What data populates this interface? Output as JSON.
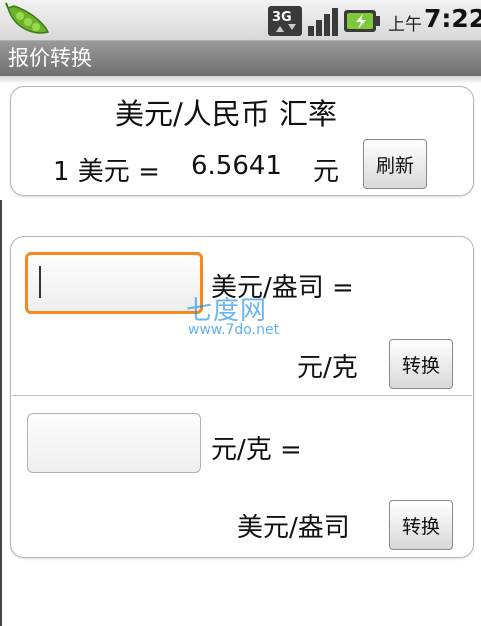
{
  "status_bar": {
    "network_label": "3G",
    "am_pm": "上午",
    "time": "7:22"
  },
  "app": {
    "title": "报价转换"
  },
  "rate_card": {
    "heading": "美元/人民币 汇率",
    "prefix": "1 美元 =",
    "rate_value": "6.5641",
    "unit": "元",
    "refresh_label": "刷新"
  },
  "convert_card": {
    "usd_oz": {
      "input_value": "",
      "unit_label": "美元/盎司 =",
      "result_unit": "元/克",
      "button_label": "转换"
    },
    "cny_g": {
      "input_value": "",
      "unit_label": "元/克 =",
      "result_unit": "美元/盎司",
      "button_label": "转换"
    }
  },
  "watermark": {
    "logo_text": "七度网",
    "url": "www.7do.net"
  },
  "colors": {
    "focus_border": "#f5891f",
    "title_bar": "#7f7f7f",
    "watermark": "#1b8fe6"
  }
}
